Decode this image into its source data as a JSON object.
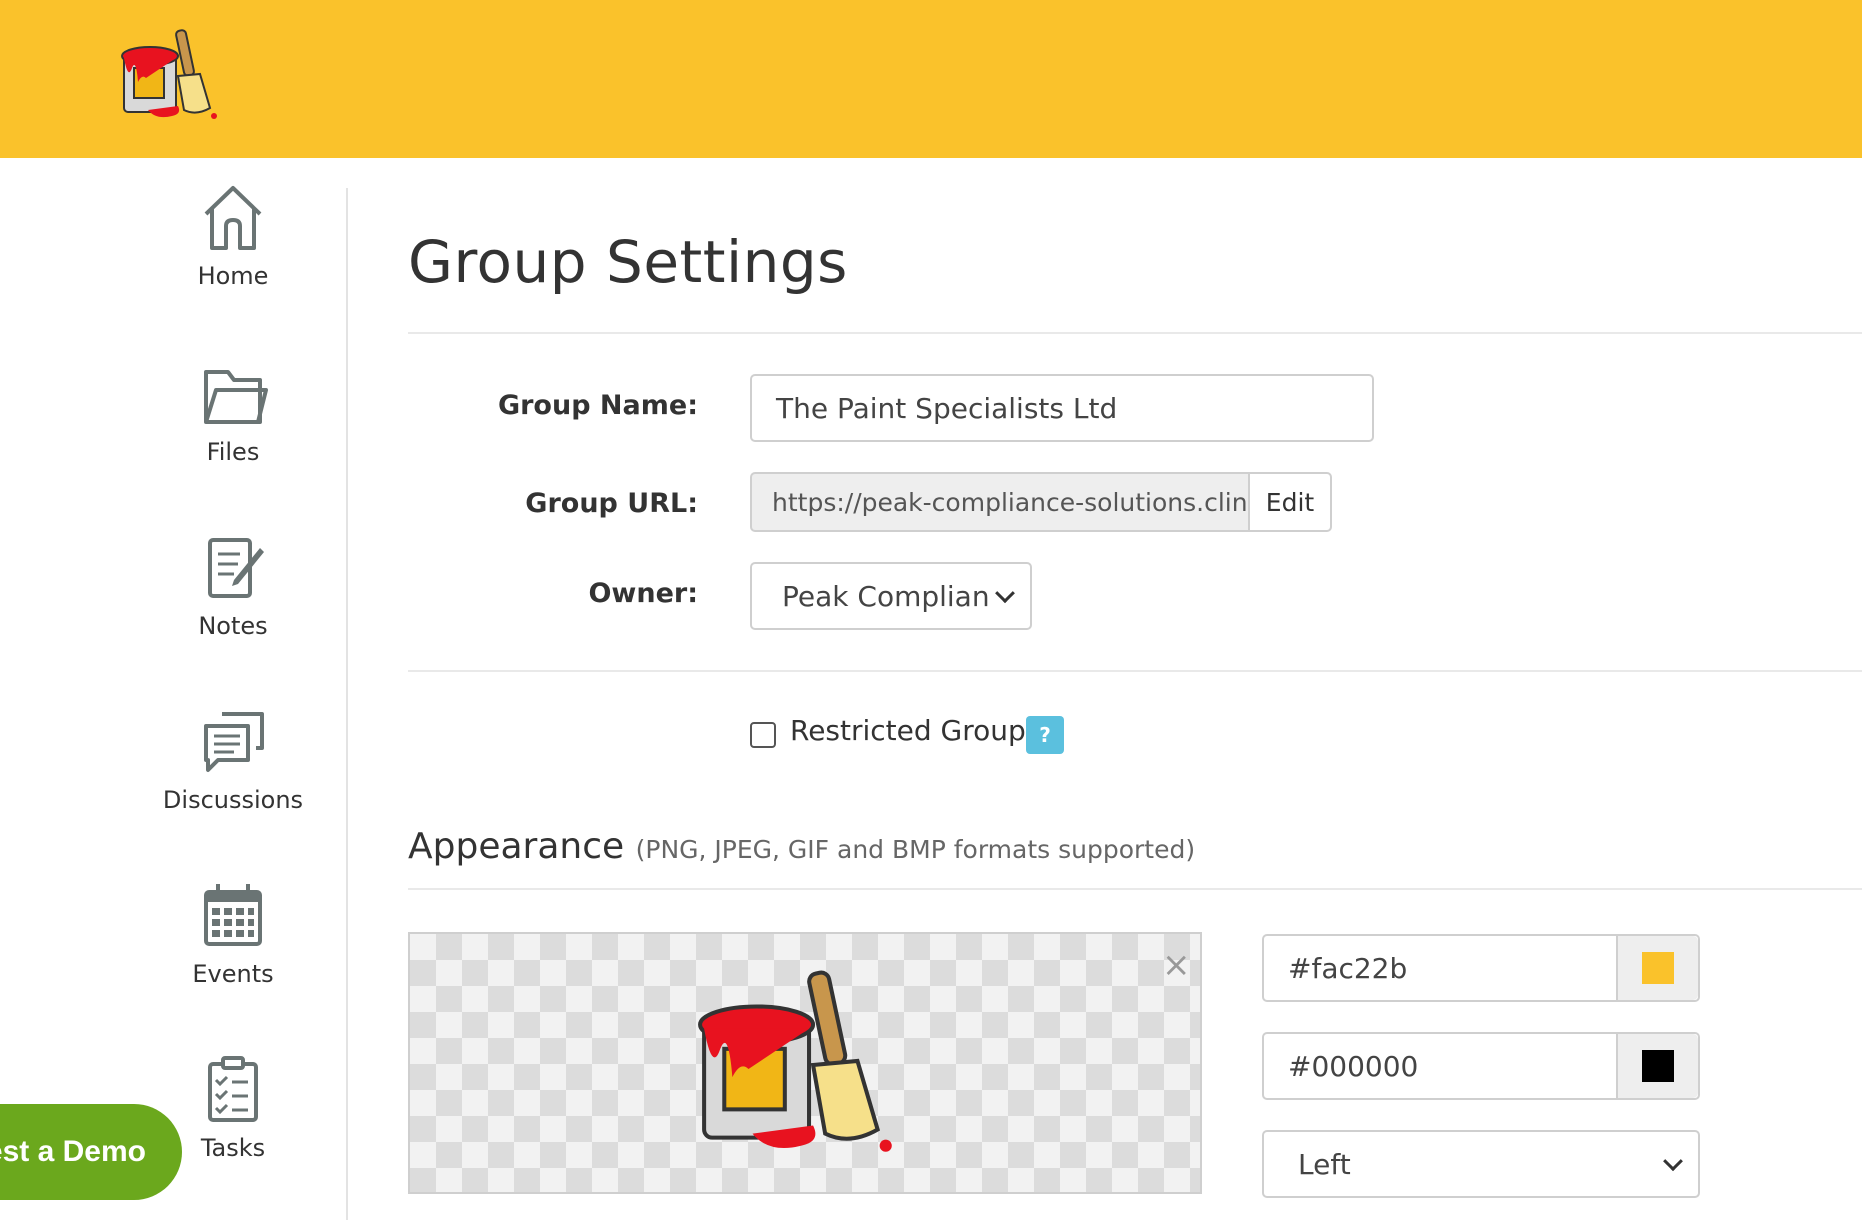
{
  "header": {
    "logo_icon": "paint-bucket-brush-logo",
    "brand_color": "#fac22b"
  },
  "sidebar": {
    "items": [
      {
        "label": "Home",
        "icon": "home-icon"
      },
      {
        "label": "Files",
        "icon": "folder-icon"
      },
      {
        "label": "Notes",
        "icon": "notes-icon"
      },
      {
        "label": "Discussions",
        "icon": "discussions-icon"
      },
      {
        "label": "Events",
        "icon": "calendar-icon"
      },
      {
        "label": "Tasks",
        "icon": "tasks-icon"
      }
    ],
    "demo_button": "est a Demo"
  },
  "main": {
    "title": "Group Settings",
    "group_name": {
      "label": "Group Name:",
      "value": "The Paint Specialists Ltd"
    },
    "group_url": {
      "label": "Group URL:",
      "value": "https://peak-compliance-solutions.clink...",
      "edit_label": "Edit"
    },
    "owner": {
      "label": "Owner:",
      "value": "Peak Complian"
    },
    "restricted": {
      "label": "Restricted Group",
      "checked": false,
      "help": "?"
    },
    "appearance": {
      "title": "Appearance",
      "note": "(PNG, JPEG, GIF and BMP formats supported)",
      "remove_icon": "×",
      "primary_color": "#fac22b",
      "secondary_color": "#000000",
      "alignment": "Left"
    }
  }
}
